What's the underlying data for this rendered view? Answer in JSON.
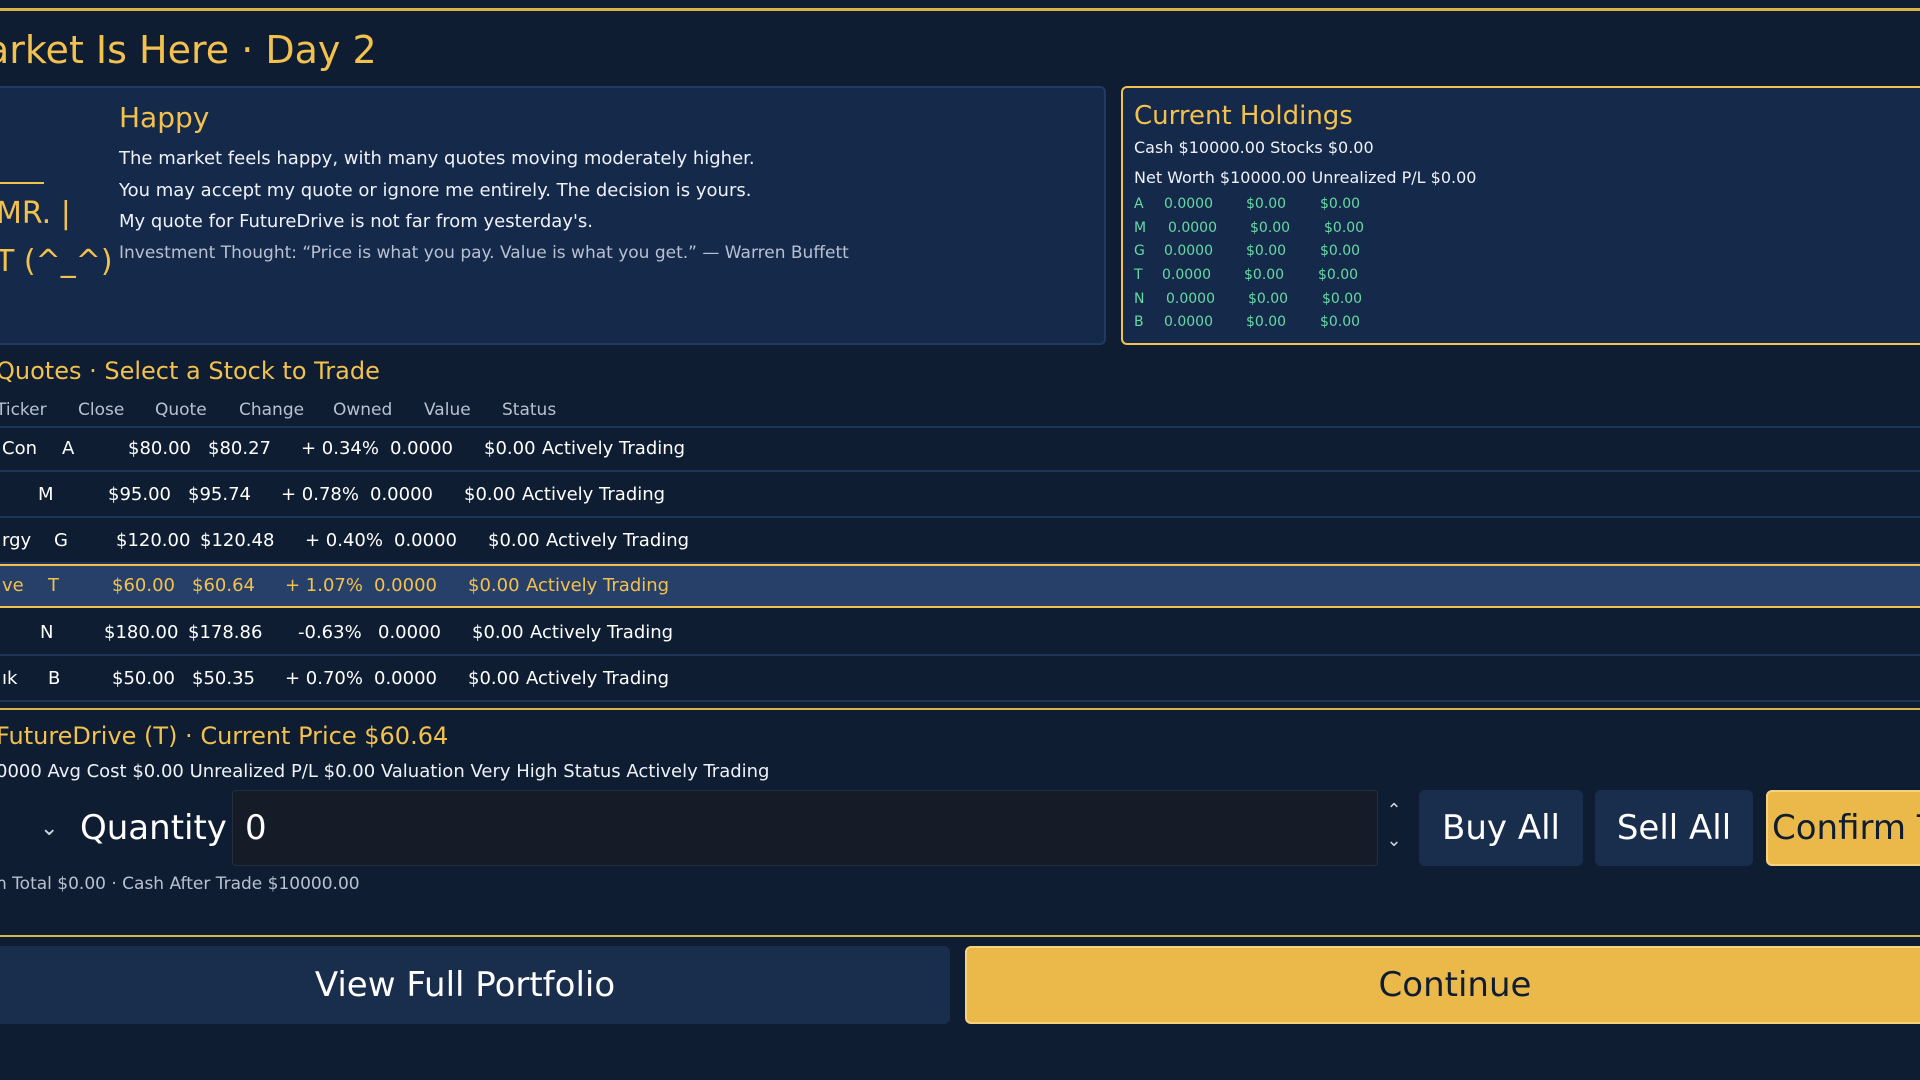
{
  "header": {
    "title": "arket Is Here · Day 2"
  },
  "advisor": {
    "name": "MR. |",
    "face": "T (^_^)",
    "mood": "Happy",
    "lines": [
      "The market feels happy, with many quotes moving moderately higher.",
      "You may accept my quote or ignore me entirely. The decision is yours.",
      "My quote for FutureDrive is not far from yesterday's."
    ],
    "thought": "Investment Thought: “Price is what you pay. Value is what you get.” — Warren Buffett"
  },
  "holdings": {
    "title": "Current Holdings",
    "line1": "Cash $10000.00  Stocks $0.00",
    "line2": "Net Worth $10000.00  Unrealized P/L $0.00",
    "rows": [
      {
        "ticker": "A",
        "shares": "0.0000",
        "value": "$0.00",
        "pl": "$0.00"
      },
      {
        "ticker": "M",
        "shares": "0.0000",
        "value": "$0.00",
        "pl": "$0.00"
      },
      {
        "ticker": "G",
        "shares": "0.0000",
        "value": "$0.00",
        "pl": "$0.00"
      },
      {
        "ticker": "T",
        "shares": "0.0000",
        "value": "$0.00",
        "pl": "$0.00"
      },
      {
        "ticker": "N",
        "shares": "0.0000",
        "value": "$0.00",
        "pl": "$0.00"
      },
      {
        "ticker": "B",
        "shares": "0.0000",
        "value": "$0.00",
        "pl": "$0.00"
      }
    ]
  },
  "quotes": {
    "title": "Quotes · Select a Stock to Trade",
    "headers": [
      "Ticker",
      "Close",
      "Quote",
      "Change",
      "Owned",
      "Value",
      "Status"
    ],
    "rows": [
      {
        "name": "Con",
        "ticker": "A",
        "close": "$80.00",
        "quote": "$80.27",
        "change": "+ 0.34%",
        "owned": "0.0000",
        "value": "$0.00",
        "status": "Actively Trading"
      },
      {
        "name": "",
        "ticker": "M",
        "close": "$95.00",
        "quote": "$95.74",
        "change": "+ 0.78%",
        "owned": "0.0000",
        "value": "$0.00",
        "status": "Actively Trading"
      },
      {
        "name": "rgy",
        "ticker": "G",
        "close": "$120.00",
        "quote": "$120.48",
        "change": "+ 0.40%",
        "owned": "0.0000",
        "value": "$0.00",
        "status": "Actively Trading"
      },
      {
        "name": "ve",
        "ticker": "T",
        "close": "$60.00",
        "quote": "$60.64",
        "change": "+ 1.07%",
        "owned": "0.0000",
        "value": "$0.00",
        "status": "Actively Trading"
      },
      {
        "name": "",
        "ticker": "N",
        "close": "$180.00",
        "quote": "$178.86",
        "change": "-0.63%",
        "owned": "0.0000",
        "value": "$0.00",
        "status": "Actively Trading"
      },
      {
        "name": "ık",
        "ticker": "B",
        "close": "$50.00",
        "quote": "$50.35",
        "change": "+ 0.70%",
        "owned": "0.0000",
        "value": "$0.00",
        "status": "Actively Trading"
      }
    ]
  },
  "trade": {
    "title": "FutureDrive (T) · Current Price $60.64",
    "info": "0000  Avg Cost $0.00  Unrealized P/L $0.00  Valuation Very High  Status Actively Trading",
    "quantity_label": "Quantity",
    "quantity_value": "0",
    "buy_all": "Buy All",
    "sell_all": "Sell All",
    "confirm": "Confirm T",
    "summary": "n Total $0.00 · Cash After Trade $10000.00"
  },
  "footer": {
    "portfolio": "View Full Portfolio",
    "continue": "Continue"
  },
  "colors": {
    "background": "#0f1d32",
    "panel": "#15294a",
    "accent_gold": "#f2c14e",
    "holding_green": "#66d9a4"
  }
}
